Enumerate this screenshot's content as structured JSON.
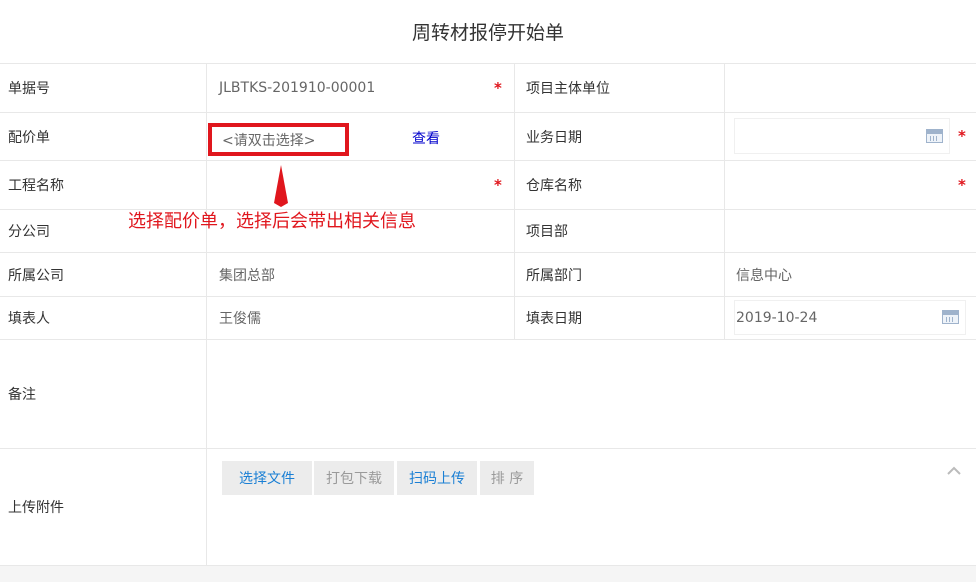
{
  "form": {
    "title": "周转材报停开始单",
    "fields": {
      "doc_no_label": "单据号",
      "doc_no_value": "JLBTKS-201910-00001",
      "project_entity_label": "项目主体单位",
      "pricing_label": "配价单",
      "pricing_placeholder": "<请双击选择>",
      "view_link": "查看",
      "business_date_label": "业务日期",
      "project_name_label": "工程名称",
      "warehouse_label": "仓库名称",
      "branch_label": "分公司",
      "project_dept_label": "项目部",
      "company_label": "所属公司",
      "company_value": "集团总部",
      "dept_label": "所属部门",
      "dept_value": "信息中心",
      "filler_label": "填表人",
      "filler_value": "王俊儒",
      "fill_date_label": "填表日期",
      "fill_date_value": "2019-10-24",
      "remarks_label": "备注",
      "attachment_label": "上传附件"
    },
    "required_mark": "*",
    "annotation": "选择配价单，选择后会带出相关信息",
    "attachment_buttons": {
      "choose_file": "选择文件",
      "download_zip": "打包下载",
      "scan_upload": "扫码上传",
      "sort": "排 序"
    },
    "colors": {
      "required": "#e0161d",
      "link": "#0000cc",
      "annotation": "#e0161d",
      "button_active": "#1a7fd4",
      "button_disabled": "#9a9a9a"
    },
    "icons": {
      "calendar": "calendar-icon",
      "collapse": "chevron-up-icon"
    }
  }
}
